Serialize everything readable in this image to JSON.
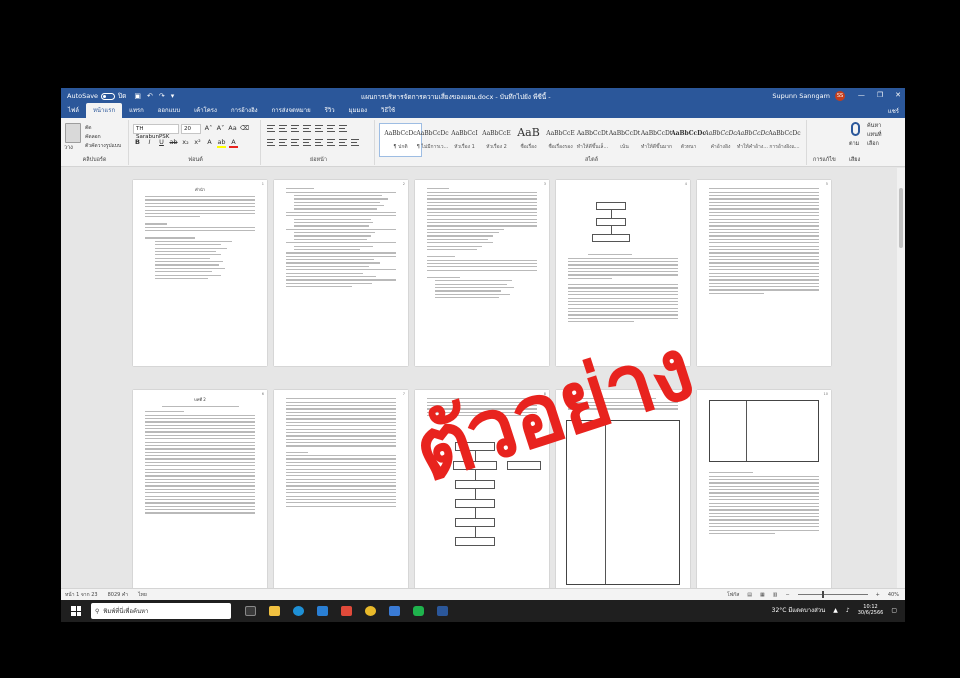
{
  "titlebar": {
    "autosave_label": "AutoSave",
    "autosave_state": "ปิด",
    "doc_title": "แผนการบริหารจัดการความเสี่ยงของแผน.docx - บันทึกไปยัง พีซีนี้ -",
    "user_name": "Supunn Sanngam",
    "user_initials": "SS"
  },
  "tabs": [
    "ไฟล์",
    "หน้าแรก",
    "แทรก",
    "ออกแบบ",
    "เค้าโครง",
    "การอ้างอิง",
    "การส่งจดหมาย",
    "รีวิว",
    "มุมมอง",
    "วิธีใช้"
  ],
  "share_label": "แชร์",
  "clipboard": {
    "paste": "วาง",
    "cut": "ตัด",
    "copy": "คัดลอก",
    "format_painter": "ตัวคัดวางรูปแบบ",
    "label": "คลิปบอร์ด"
  },
  "font": {
    "name": "TH SarabunPSK",
    "size": "20",
    "label": "ฟอนต์"
  },
  "paragraph_label": "ย่อหน้า",
  "styles": {
    "label": "สไตล์",
    "items": [
      {
        "sample": "AaBbCcDc",
        "name": "¶ ปกติ"
      },
      {
        "sample": "AaBbCcDc",
        "name": "¶ ไม่มีการเว..."
      },
      {
        "sample": "AaBbCcI",
        "name": "หัวเรื่อง 1"
      },
      {
        "sample": "AaBbCcE",
        "name": "หัวเรื่อง 2"
      },
      {
        "sample": "AaB",
        "name": "ชื่อเรื่อง"
      },
      {
        "sample": "AaBbCcE",
        "name": "ชื่อเรื่องรอง"
      },
      {
        "sample": "AaBbCcDt",
        "name": "ทำให้ดีขึ้นเล็..."
      },
      {
        "sample": "AaBbCcDt",
        "name": "เน้น"
      },
      {
        "sample": "AaBbCcDt",
        "name": "ทำให้ดีขึ้นมาก"
      },
      {
        "sample": "AaBbCcDc",
        "name": "ตัวหนา"
      },
      {
        "sample": "AaBbCcDc",
        "name": "คำอ้างอิง"
      },
      {
        "sample": "AaBbCcDc",
        "name": "ทำให้คำอ้าง..."
      },
      {
        "sample": "AaBbCcDc",
        "name": "การอ้างอิงแ..."
      }
    ]
  },
  "editing": {
    "find": "ค้นหา",
    "replace": "แทนที่",
    "select": "เลือก",
    "label": "การแก้ไข"
  },
  "voice": {
    "dictate": "ตาม",
    "label": "เสียง"
  },
  "watermark": "ตัวอย่าง",
  "statusbar": {
    "page": "หน้า 1 จาก 23",
    "words": "8029 คำ",
    "language": "ไทย",
    "focus": "โฟกัส",
    "zoom": "40%"
  },
  "taskbar": {
    "search_placeholder": "พิมพ์ที่นี่เพื่อค้นหา",
    "weather": "32°C มีแดดบางส่วน",
    "time": "10:12",
    "date": "30/6/2566"
  },
  "pages": {
    "p1_title": "คำนำ",
    "p5_title": "บทที่ 2"
  }
}
